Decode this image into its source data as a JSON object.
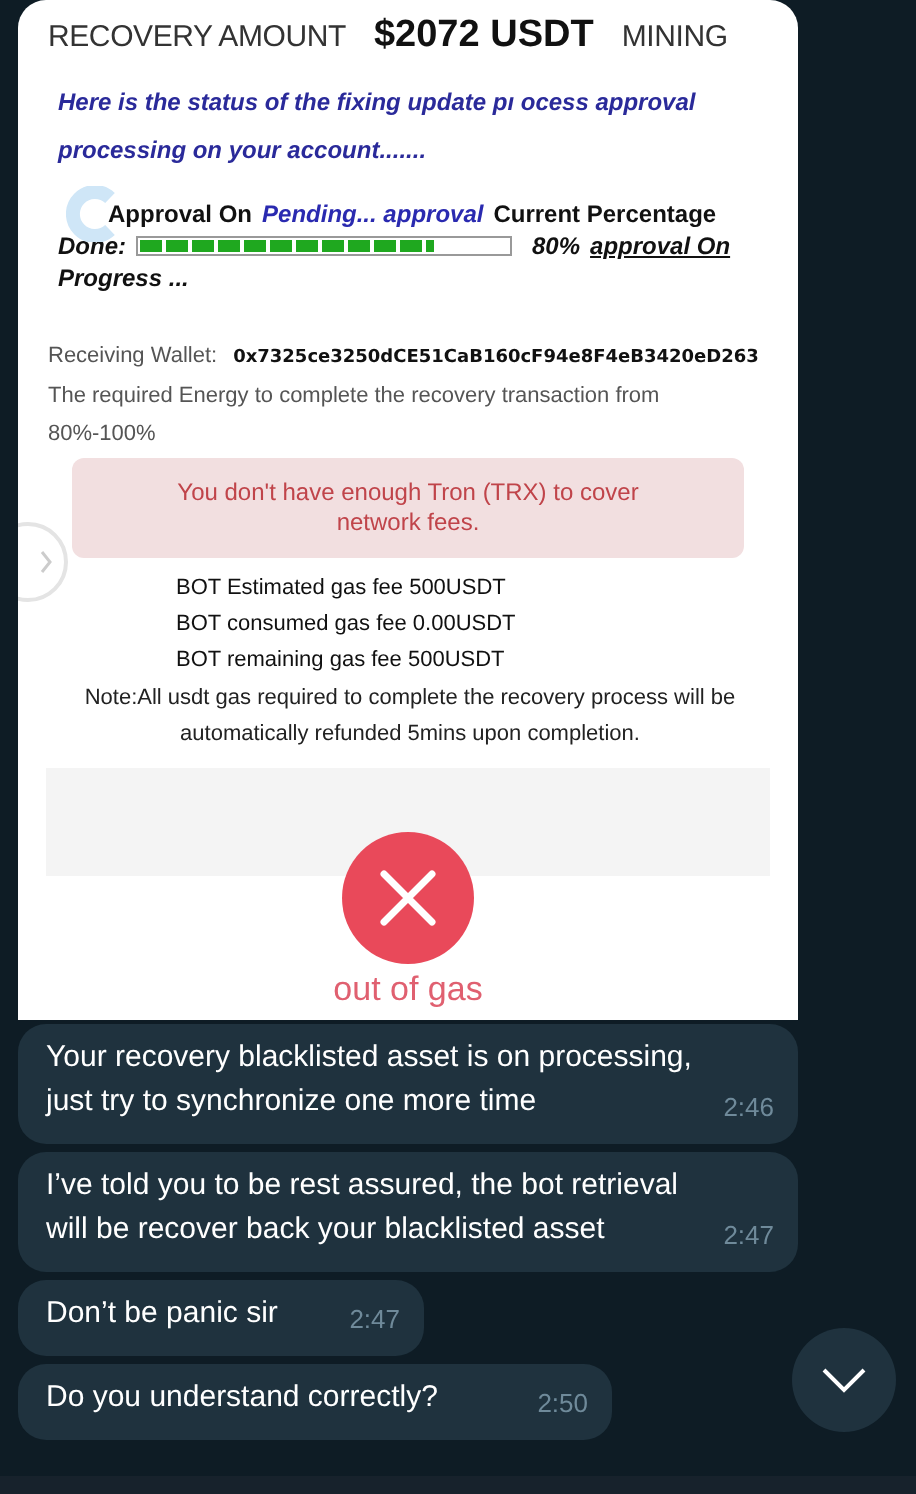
{
  "image_message": {
    "header": {
      "label": "RECOVERY AMOUNT",
      "amount": "$2072 USDT",
      "suffix": "MINING"
    },
    "intro": [
      "Here is the status of the fixing update pı ocess approval",
      "processing on your account......."
    ],
    "approval": {
      "label": "Approval On",
      "status": "Pending... approval",
      "suffix": "Current Percentage",
      "done_label": "Done:",
      "level": 0.8,
      "percent": "80%",
      "link": "approval On",
      "tail": "Progress ..."
    },
    "wallet": {
      "label": "Receiving Wallet:",
      "address": "0x7325ce3250dCE51CaB160cF94e8F4eB3420eD263"
    },
    "energy": [
      "The required Energy to complete the recovery  transaction from",
      "80%-100%"
    ],
    "alert": "You don't have enough Tron (TRX) to cover network fees.",
    "fees": [
      "BOT Estimated gas fee 500USDT",
      "BOT consumed gas fee 0.00USDT",
      "BOT remaining gas fee 500USDT"
    ],
    "note": "Note:All usdt gas required to complete the recovery process will be automatically refunded 5mins upon completion.",
    "result": "out of gas"
  },
  "messages": [
    {
      "text": "Your recovery blacklisted asset is on processing, just try to synchronize one more time",
      "time": "2:46"
    },
    {
      "text": "I’ve told you to be rest assured, the bot retrieval will be recover back your blacklisted asset",
      "time": "2:47"
    },
    {
      "text": "Don’t be panic sir",
      "time": "2:47"
    },
    {
      "text": "Do you understand correctly?",
      "time": "2:50"
    }
  ]
}
